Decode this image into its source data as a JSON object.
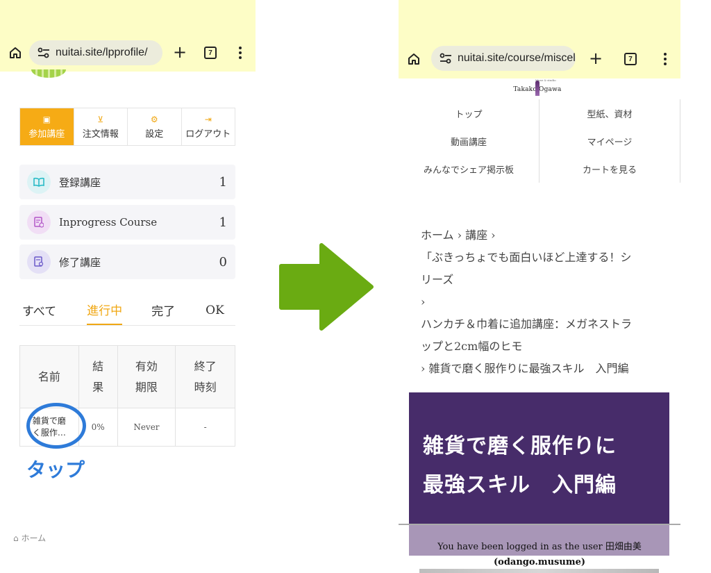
{
  "left": {
    "browser": {
      "url": "nuitai.site/lpprofile/",
      "tab_count": "7"
    },
    "menu_tabs": [
      {
        "icon": "book-add-icon",
        "label": "参加講座",
        "active": true
      },
      {
        "icon": "cart-icon",
        "label": "注文情報",
        "active": false
      },
      {
        "icon": "gear-icon",
        "label": "設定",
        "active": false
      },
      {
        "icon": "logout-icon",
        "label": "ログアウト",
        "active": false
      }
    ],
    "stats": [
      {
        "icon": "open-book-icon",
        "label": "登録講座",
        "count": "1",
        "color": "#1fb8c4",
        "bg": "#ddf3f5"
      },
      {
        "icon": "document-clock-icon",
        "label": "Inprogress Course",
        "count": "1",
        "color": "#b256c8",
        "bg": "#f1def5"
      },
      {
        "icon": "document-badge-icon",
        "label": "修了講座",
        "count": "0",
        "color": "#6a58c9",
        "bg": "#e4e0f6"
      }
    ],
    "filter_tabs": [
      "すべて",
      "進行中",
      "完了",
      "OK"
    ],
    "table": {
      "headers": [
        "名前",
        "結\n果",
        "有効\n期限",
        "終了\n時刻"
      ],
      "row": {
        "name": "雑貨で磨\nく服作…",
        "result": "0%",
        "expiry": "Never",
        "end": "-"
      }
    },
    "annotation": "タップ",
    "breadcrumb_home": "ホーム"
  },
  "right": {
    "browser": {
      "url": "nuitai.site/course/miscel",
      "tab_count": "7"
    },
    "brand": {
      "text": "Takako Ogawa",
      "small": "Muse & studio"
    },
    "nav": [
      "トップ",
      "型紙、資材",
      "動画講座",
      "マイページ",
      "みんなでシェア掲示板",
      "カートを見る"
    ],
    "breadcrumb": [
      "ホーム › 講座 ›",
      "「ぶきっちょでも面白いほど上達する！シ",
      "リーズ",
      "›",
      "ハンカチ＆巾着に追加講座：メガネストラ",
      "ップと2cm幅のヒモ",
      "› 雑貨で磨く服作りに最強スキル　入門編"
    ],
    "hero_title_line1": "雑貨で磨く服作りに",
    "hero_title_line2": "最強スキル　入門編",
    "logged_in_text": "You have been logged in as the user 田畑由美",
    "logged_in_user": "(odango.musume)"
  },
  "colors": {
    "accent": "#f6ab15",
    "hero": "#472c6a",
    "annotation": "#2e7bd9",
    "arrow": "#6aab12",
    "chrome": "#fdfdc6"
  }
}
